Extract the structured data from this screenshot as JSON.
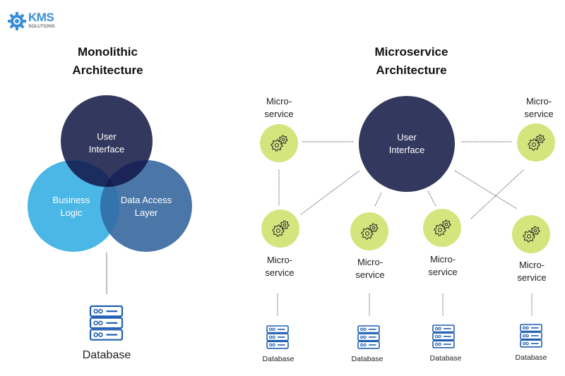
{
  "logo": {
    "brand": "KMS",
    "sub": "SOLUTIONS",
    "color": "#3a8ed8"
  },
  "monolithic": {
    "title_line1": "Monolithic",
    "title_line2": "Architecture",
    "circles": [
      {
        "id": "ui",
        "line1": "User",
        "line2": "Interface",
        "color": "#33385e"
      },
      {
        "id": "bl",
        "line1": "Business",
        "line2": "Logic",
        "color": "#4ab7e6"
      },
      {
        "id": "dal",
        "line1": "Data Access",
        "line2": "Layer",
        "color": "#4b77a8"
      }
    ],
    "database_label": "Database"
  },
  "microservice": {
    "title_line1": "Microservice",
    "title_line2": "Architecture",
    "center": {
      "line1": "User",
      "line2": "Interface",
      "color": "#33385e"
    },
    "service_color": "#d4e57e",
    "services": [
      {
        "line1": "Micro-",
        "line2": "service"
      },
      {
        "line1": "Micro-",
        "line2": "service"
      },
      {
        "line1": "Micro-",
        "line2": "service"
      },
      {
        "line1": "Micro-",
        "line2": "service"
      },
      {
        "line1": "Micro-",
        "line2": "service"
      },
      {
        "line1": "Micro-",
        "line2": "service"
      }
    ],
    "databases": [
      "Database",
      "Database",
      "Database",
      "Database"
    ]
  },
  "colors": {
    "db_icon": "#1f5fb4",
    "connector": "#555555"
  }
}
